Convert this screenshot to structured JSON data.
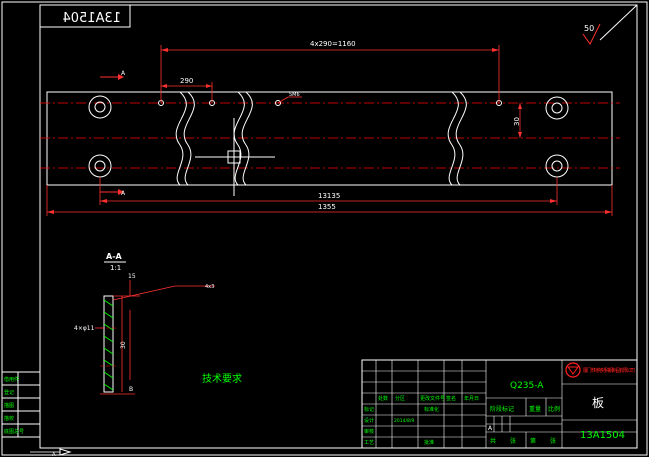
{
  "colors": {
    "background": "#000000",
    "outline": "#ffffff",
    "dimension": "#ff3030",
    "dim_text": "#ffffff",
    "title_table_text": "#00ff00",
    "company_logo": "#ff2020",
    "centerline": "#ff0000"
  },
  "drawing": {
    "stamp_mirrored": "13A1504",
    "roughness_symbol": "50",
    "dim_spacing": "4x290=1160",
    "dim_290": "290",
    "hole_note": "5M6",
    "dim_30": "30",
    "dim_13135": "13135",
    "dim_1355": "1355",
    "marker_a_top": "A",
    "marker_a_bottom": "A",
    "section_label": "A-A",
    "section_scale": "1:1",
    "section_15": "15",
    "section_4x3": "4x3",
    "section_4x_hole": "4×φ11",
    "section_side_dim": "30",
    "section_b": "B",
    "tech_req": "技术要求"
  },
  "title_block": {
    "company": "厦门市特克 特殊钢制品有限公司",
    "material": "Q235-A",
    "part_name": "板",
    "drawing_no": "13A1504",
    "header_stage": "阶段标记",
    "header_weight": "重量",
    "header_scale": "比例",
    "stage_mark": "A",
    "sheet_total": "共",
    "sheet_label": "张",
    "sheet_page": "第",
    "sheet_label2": "张",
    "row_labels": [
      "标记",
      "设计",
      "审核",
      "工艺"
    ],
    "col_labels": [
      "处数",
      "分区",
      "更改文件号",
      "签名",
      "年月日"
    ],
    "standard": "标准化",
    "approve": "批准",
    "date": "2014/8/9",
    "biaozhun_label": "标准化"
  },
  "left_stamp": {
    "labels": [
      "借用件",
      "登记",
      "描图",
      "描校",
      "底图总号"
    ]
  },
  "bottom_arrow": "A"
}
